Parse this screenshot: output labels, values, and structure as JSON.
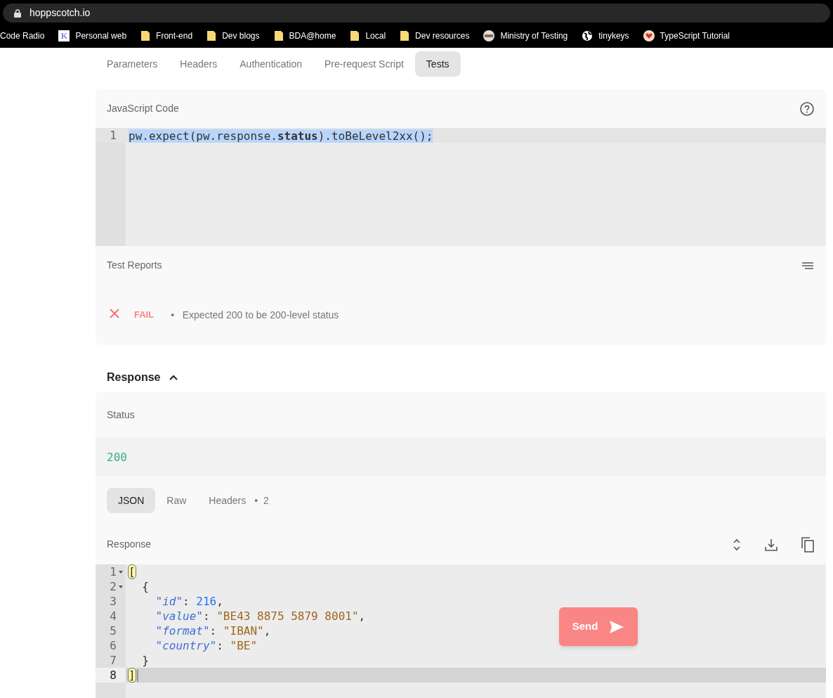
{
  "browser": {
    "url": "hoppscotch.io",
    "bookmarks": [
      {
        "label": "Code Radio",
        "kind": "plain"
      },
      {
        "label": "Personal web",
        "kind": "letter",
        "letter": "K"
      },
      {
        "label": "Front-end",
        "kind": "folder"
      },
      {
        "label": "Dev blogs",
        "kind": "folder"
      },
      {
        "label": "BDA@home",
        "kind": "folder"
      },
      {
        "label": "Local",
        "kind": "folder"
      },
      {
        "label": "Dev resources",
        "kind": "folder"
      },
      {
        "label": "Ministry of Testing",
        "kind": "face"
      },
      {
        "label": "tinykeys",
        "kind": "globe"
      },
      {
        "label": "TypeScript Tutorial",
        "kind": "heart"
      }
    ]
  },
  "request_tabs": [
    {
      "label": "Parameters",
      "selected": false
    },
    {
      "label": "Headers",
      "selected": false
    },
    {
      "label": "Authentication",
      "selected": false
    },
    {
      "label": "Pre-request Script",
      "selected": false
    },
    {
      "label": "Tests",
      "selected": true
    }
  ],
  "tests_editor": {
    "title": "JavaScript Code",
    "lines": [
      {
        "number": "1",
        "text": "pw.expect(pw.response.**status**).toBeLevel2xx();",
        "selected": true
      }
    ]
  },
  "test_reports": {
    "title": "Test Reports",
    "results": [
      {
        "status": "FAIL",
        "passed": false,
        "separator": "•",
        "message": "Expected 200 to be 200-level status"
      }
    ]
  },
  "response": {
    "title": "Response",
    "expanded": true,
    "status_label": "Status",
    "status_code": "200",
    "tabs": [
      {
        "label": "JSON",
        "selected": true
      },
      {
        "label": "Raw",
        "selected": false
      },
      {
        "label": "Headers",
        "separator": "•",
        "count": "2",
        "selected": false
      }
    ],
    "body_label": "Response",
    "lines": [
      {
        "number": "1",
        "foldable": true,
        "active": false,
        "tokens": [
          {
            "kind": "bracket",
            "text": "["
          }
        ]
      },
      {
        "number": "2",
        "foldable": true,
        "active": false,
        "tokens": [
          {
            "kind": "punct",
            "text": "  {"
          }
        ]
      },
      {
        "number": "3",
        "foldable": false,
        "active": false,
        "tokens": [
          {
            "kind": "key",
            "text": "    \"id\""
          },
          {
            "kind": "punct",
            "text": ": "
          },
          {
            "kind": "number",
            "text": "216"
          },
          {
            "kind": "punct",
            "text": ","
          }
        ]
      },
      {
        "number": "4",
        "foldable": false,
        "active": false,
        "tokens": [
          {
            "kind": "key",
            "text": "    \"value\""
          },
          {
            "kind": "punct",
            "text": ": "
          },
          {
            "kind": "string",
            "text": "\"BE43 8875 5879 8001\""
          },
          {
            "kind": "punct",
            "text": ","
          }
        ]
      },
      {
        "number": "5",
        "foldable": false,
        "active": false,
        "tokens": [
          {
            "kind": "key",
            "text": "    \"format\""
          },
          {
            "kind": "punct",
            "text": ": "
          },
          {
            "kind": "string",
            "text": "\"IBAN\""
          },
          {
            "kind": "punct",
            "text": ","
          }
        ]
      },
      {
        "number": "6",
        "foldable": false,
        "active": false,
        "tokens": [
          {
            "kind": "key",
            "text": "    \"country\""
          },
          {
            "kind": "punct",
            "text": ": "
          },
          {
            "kind": "string",
            "text": "\"BE\""
          }
        ]
      },
      {
        "number": "7",
        "foldable": false,
        "active": false,
        "tokens": [
          {
            "kind": "punct",
            "text": "  }"
          }
        ]
      },
      {
        "number": "8",
        "foldable": false,
        "active": true,
        "tokens": [
          {
            "kind": "bracket",
            "text": "]"
          }
        ]
      }
    ]
  },
  "send_button": {
    "label": "Send"
  }
}
